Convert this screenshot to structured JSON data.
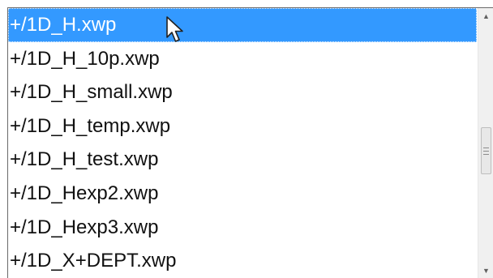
{
  "listbox": {
    "items": [
      {
        "label": "+/1D_H.xwp"
      },
      {
        "label": "+/1D_H_10p.xwp"
      },
      {
        "label": "+/1D_H_small.xwp"
      },
      {
        "label": "+/1D_H_temp.xwp"
      },
      {
        "label": "+/1D_H_test.xwp"
      },
      {
        "label": "+/1D_Hexp2.xwp"
      },
      {
        "label": "+/1D_Hexp3.xwp"
      },
      {
        "label": "+/1D_X+DEPT.xwp"
      }
    ],
    "selected_index": 0
  },
  "scrollbar": {
    "up_icon": "scroll-up-arrow-icon",
    "down_icon": "scroll-down-arrow-icon",
    "thumb_icon": "grip-lines-icon"
  },
  "colors": {
    "selection": "#3399ff",
    "selection_text": "#ffffff",
    "text": "#111111",
    "border": "#6a6a6a"
  }
}
